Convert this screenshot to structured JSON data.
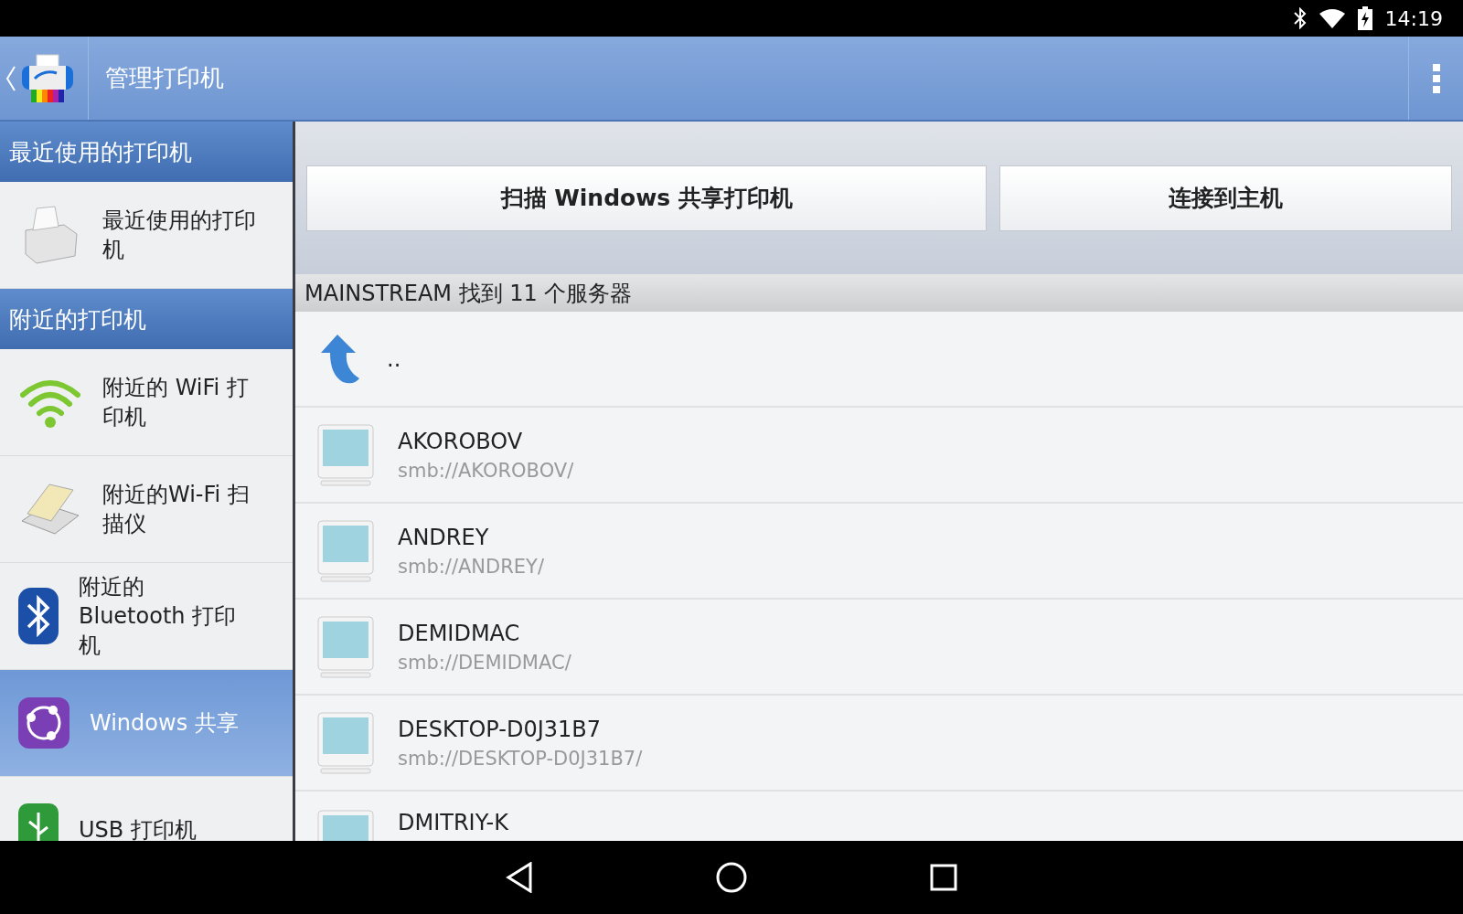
{
  "status_bar": {
    "time": "14:19"
  },
  "app_bar": {
    "title": "管理打印机"
  },
  "sidebar": {
    "sections": [
      {
        "title": "最近使用的打印机",
        "items": [
          {
            "kind": "printer",
            "label": "最近使用的打印机",
            "selected": false
          }
        ]
      },
      {
        "title": "附近的打印机",
        "items": [
          {
            "kind": "wifi",
            "label": "附近的 WiFi 打印机",
            "selected": false
          },
          {
            "kind": "scanner",
            "label": "附近的Wi-Fi 扫描仪",
            "selected": false
          },
          {
            "kind": "bluetooth",
            "label": "附近的 Bluetooth 打印机",
            "selected": false
          },
          {
            "kind": "share",
            "label": "Windows 共享",
            "selected": true
          },
          {
            "kind": "usb",
            "label": "USB 打印机",
            "selected": false
          }
        ]
      }
    ]
  },
  "main": {
    "buttons": [
      "扫描 Windows 共享打印机",
      "连接到主机"
    ],
    "list_header": "MAINSTREAM 找到 11 个服务器",
    "rows": [
      {
        "kind": "up",
        "name": ".."
      },
      {
        "kind": "computer",
        "name": "AKOROBOV",
        "path": "smb://AKOROBOV/"
      },
      {
        "kind": "computer",
        "name": "ANDREY",
        "path": "smb://ANDREY/"
      },
      {
        "kind": "computer",
        "name": "DEMIDMAC",
        "path": "smb://DEMIDMAC/"
      },
      {
        "kind": "computer",
        "name": "DESKTOP-D0J31B7",
        "path": "smb://DESKTOP-D0J31B7/"
      },
      {
        "kind": "computer",
        "name": "DMITRIY-K"
      }
    ]
  }
}
